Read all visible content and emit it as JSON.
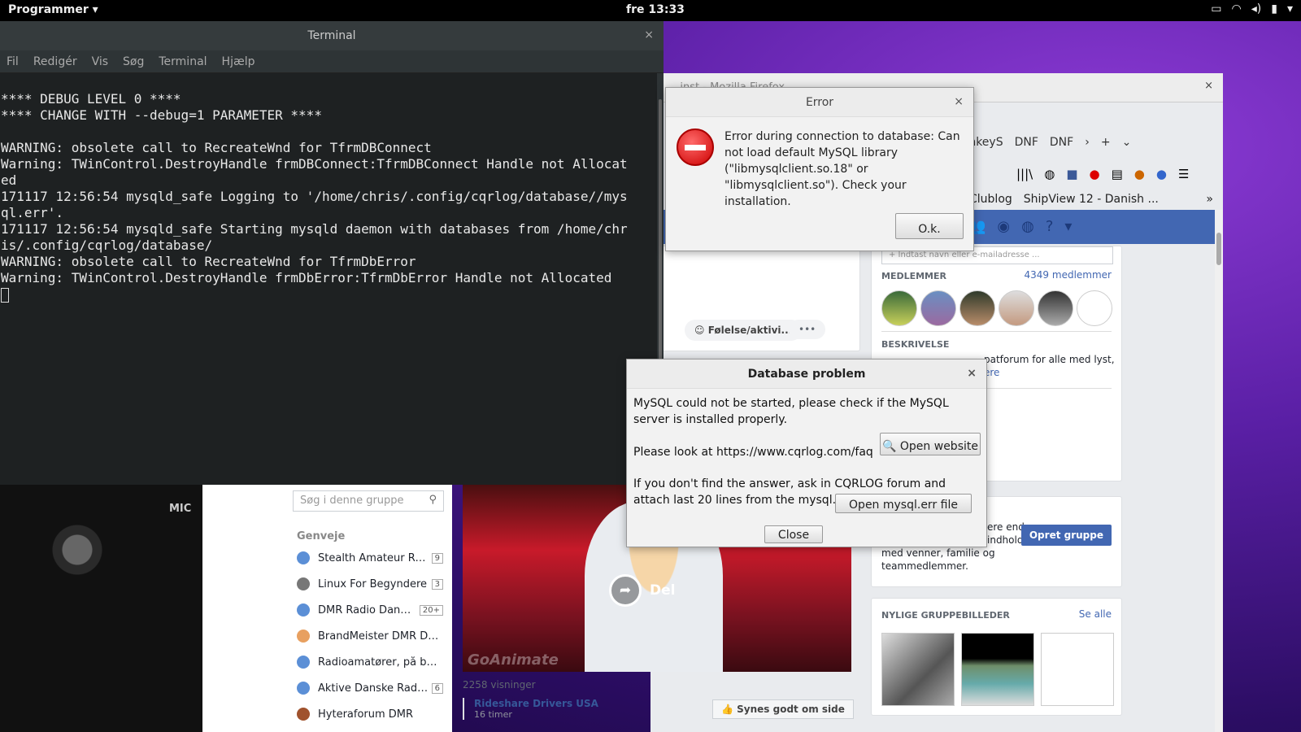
{
  "topbar": {
    "apps_label": "Programmer ▾",
    "clock": "fre 13:33",
    "tray_icons": [
      "display-icon",
      "wifi-icon",
      "volume-icon",
      "battery-icon",
      "power-menu-icon"
    ]
  },
  "firefox": {
    "title": "...inst - Mozilla Firefox",
    "tabs": [
      "jWinkeyS",
      "DNF",
      "DNF"
    ],
    "bookmarks": [
      "Clublog",
      "ShipView 12 - Danish ..."
    ],
    "invite_placeholder": "+ Indtast navn eller e-mailadresse ...",
    "members_label": "MEDLEMMER",
    "members_count": "4349 medlemmer",
    "description_label": "BESKRIVELSE",
    "description_text": "patforum for alle med lyst,",
    "description_more": "ere",
    "create_text_1": "ere end",
    "create_text_2": "indhold",
    "create_text_3": "med venner, familie og",
    "create_text_4": "teammedlemmer.",
    "create_button": "Opret gruppe",
    "photos_label": "NYLIGE GRUPPEBILLEDER",
    "photos_all": "Se alle",
    "feeling_label": "Følelse/aktivi...",
    "dots_label": "•••",
    "search_placeholder": "Søg i denne gruppe",
    "shortcuts_title": "Genveje",
    "shortcuts": [
      {
        "label": "Stealth Amateur Radio",
        "count": "9",
        "color": "#5b8fd6"
      },
      {
        "label": "Linux For Begyndere",
        "count": "3",
        "color": "#777"
      },
      {
        "label": "DMR Radio Danmark",
        "count": "20+",
        "color": "#5b8fd6"
      },
      {
        "label": "BrandMeister DMR Dan...",
        "count": "",
        "color": "#e8a060"
      },
      {
        "label": "Radioamatører, på bølg...",
        "count": "",
        "color": "#5b8fd6"
      },
      {
        "label": "Aktive Danske Radio...",
        "count": "6",
        "color": "#5b8fd6"
      },
      {
        "label": "Hyteraforum DMR",
        "count": "",
        "color": "#a0522d"
      }
    ],
    "video_share": "Del",
    "video_watermark": "GoAnimate",
    "views": "2258 visninger",
    "poster_name": "Rideshare Drivers USA",
    "poster_time": "16 timer",
    "like_page": "Synes godt om side"
  },
  "background": {
    "mic_label": "MIC"
  },
  "terminal": {
    "title": "Terminal",
    "menu": [
      "Fil",
      "Redigér",
      "Vis",
      "Søg",
      "Terminal",
      "Hjælp"
    ],
    "lines": [
      "**** DEBUG LEVEL 0 ****",
      "**** CHANGE WITH --debug=1 PARAMETER ****",
      "",
      "WARNING: obsolete call to RecreateWnd for TfrmDBConnect",
      "Warning: TWinControl.DestroyHandle frmDBConnect:TfrmDBConnect Handle not Allocat",
      "ed",
      "171117 12:56:54 mysqld_safe Logging to '/home/chris/.config/cqrlog/database//mys",
      "ql.err'.",
      "171117 12:56:54 mysqld_safe Starting mysqld daemon with databases from /home/chr",
      "is/.config/cqrlog/database/",
      "WARNING: obsolete call to RecreateWnd for TfrmDbError",
      "Warning: TWinControl.DestroyHandle frmDbError:TfrmDbError Handle not Allocated"
    ]
  },
  "error_dialog": {
    "title": "Error",
    "message": "Error during connection to database: Can not load default MySQL library (\"libmysqlclient.so.18\" or \"libmysqlclient.so\"). Check your installation.",
    "ok_label": "O.k."
  },
  "db_dialog": {
    "title": "Database problem",
    "line1": "MySQL could not be started, please check if the MySQL server is installed properly.",
    "line2": "Please look at https://www.cqrlog.com/faq",
    "line3": "If you don't find the answer, ask in CQRLOG forum and attach last 20 lines from the mysql.err file.",
    "open_website": "🔍 Open website",
    "open_err_file": "Open mysql.err file",
    "close": "Close"
  }
}
